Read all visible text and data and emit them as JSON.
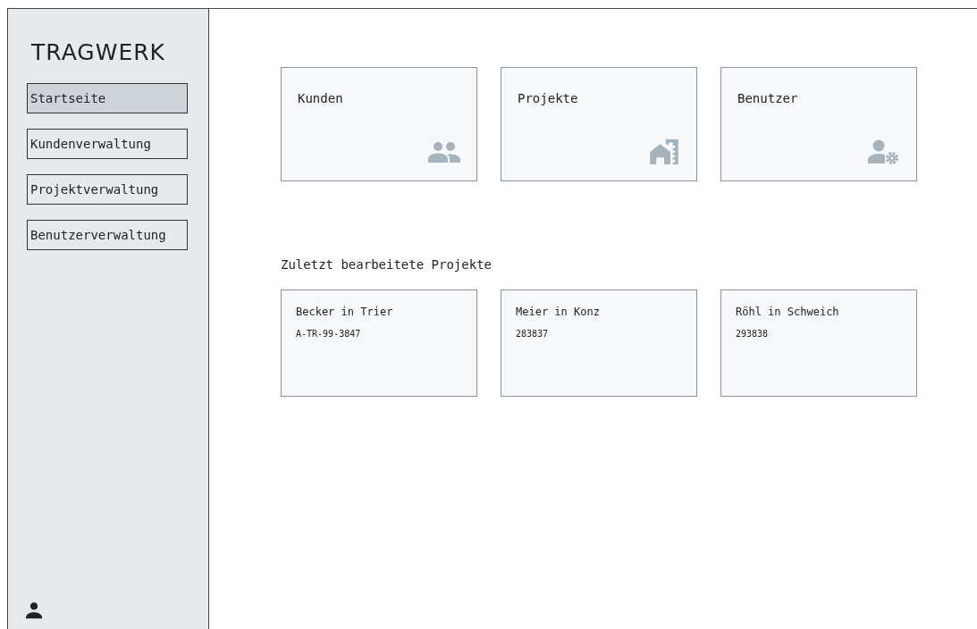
{
  "sidebar": {
    "logo": "TRAGWERK",
    "items": [
      {
        "label": "Startseite",
        "selected": true
      },
      {
        "label": "Kundenverwaltung",
        "selected": false
      },
      {
        "label": "Projektverwaltung",
        "selected": false
      },
      {
        "label": "Benutzerverwaltung",
        "selected": false
      }
    ]
  },
  "tiles": [
    {
      "label": "Kunden",
      "kind": "customers"
    },
    {
      "label": "Projekte",
      "kind": "projects"
    },
    {
      "label": "Benutzer",
      "kind": "users"
    }
  ],
  "recent": {
    "heading": "Zuletzt bearbeitete Projekte",
    "projects": [
      {
        "name": "Becker in Trier",
        "number": "A-TR-99-3847"
      },
      {
        "name": "Meier in Konz",
        "number": "283837"
      },
      {
        "name": "Röhl in Schweich",
        "number": "293838"
      }
    ]
  }
}
